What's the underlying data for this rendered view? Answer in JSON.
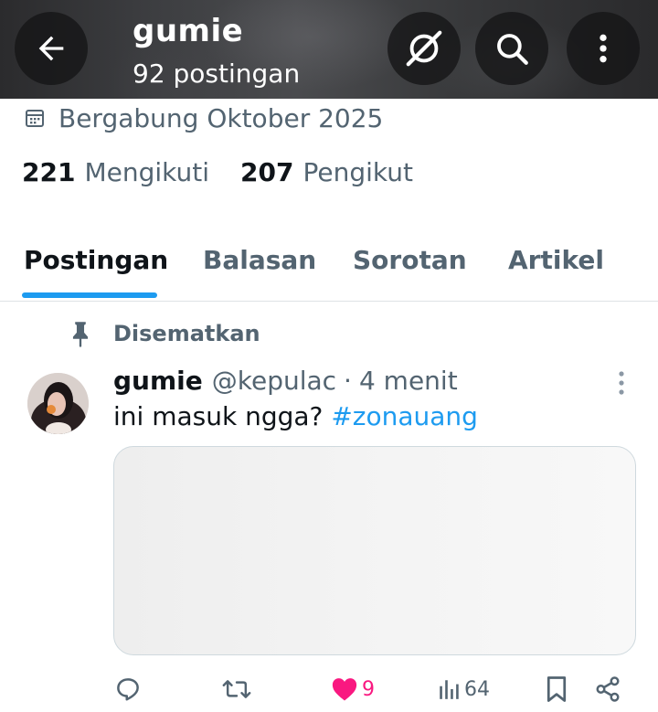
{
  "header": {
    "name": "gumie",
    "post_count": "92 postingan"
  },
  "profile": {
    "joined": "Bergabung Oktober 2025",
    "following_count": "221",
    "following_label": "Mengikuti",
    "followers_count": "207",
    "followers_label": "Pengikut"
  },
  "tabs": [
    {
      "label": "Postingan",
      "active": true
    },
    {
      "label": "Balasan",
      "active": false
    },
    {
      "label": "Sorotan",
      "active": false
    },
    {
      "label": "Artikel",
      "active": false
    }
  ],
  "pinned_label": "Disematkan",
  "post": {
    "name": "gumie",
    "handle": "@kepulac",
    "separator": "·",
    "time": "4 menit",
    "text": "ini masuk ngga?",
    "hashtag": "#zonauang",
    "actions": {
      "likes": "9",
      "views": "64"
    }
  },
  "icons": {
    "back": "arrow-left-icon",
    "grok": "grok-icon",
    "search": "search-icon",
    "more": "more-vertical-icon",
    "calendar": "calendar-icon",
    "pin": "pin-icon",
    "reply": "reply-icon",
    "repost": "repost-icon",
    "like": "heart-icon",
    "views": "views-icon",
    "bookmark": "bookmark-icon",
    "share": "share-icon"
  },
  "colors": {
    "accent": "#1d9bf0",
    "like": "#f91880",
    "muted": "#536471",
    "text": "#0f1419"
  }
}
